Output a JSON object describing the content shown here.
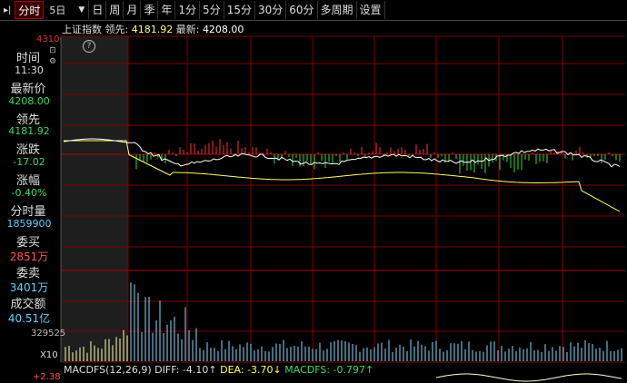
{
  "toolbar": {
    "pin": "▸|",
    "items": [
      "分时",
      "5日",
      "日",
      "周",
      "月",
      "季",
      "年",
      "1分",
      "5分",
      "15分",
      "30分",
      "60分",
      "多周期",
      "设置"
    ]
  },
  "info": {
    "index_name": "上证指数",
    "lead_label": "领先:",
    "lead_value": "4181.92",
    "latest_label": "最新:",
    "latest_value": "4208.00"
  },
  "price_scale_top": "4310",
  "volume_scale": "329525",
  "volume_multiplier": "X10",
  "macd_scale_bottom": "+2.38",
  "sidebar": {
    "time_label": "时间",
    "time_value": "11:30",
    "latest_label": "最新价",
    "latest_value": "4208.00",
    "lead_label": "领先",
    "lead_value": "4181.92",
    "change_label": "涨跌",
    "change_value": "-17.02",
    "pct_label": "涨幅",
    "pct_value": "-0.40%",
    "vol_label": "分时量",
    "vol_value": "1859900",
    "bid_label": "委买",
    "bid_value": "2851万",
    "ask_label": "委卖",
    "ask_value": "3401万",
    "amount_label": "成交额",
    "amount_value": "40.51亿"
  },
  "macd": {
    "title": "MACDFS(12,26,9)",
    "diff_label": "DIFF:",
    "diff_value": "-4.10↑",
    "dea_label": "DEA:",
    "dea_value": "-3.70↓",
    "macdfs_label": "MACDFS:",
    "macdfs_value": "-0.797↑"
  },
  "colors": {
    "grid": "#7a0000",
    "price_line": "#ffffff",
    "avg_line": "#ffff66",
    "up_bar": "#ff3030",
    "down_bar": "#33dd33",
    "vol_bar": "#88ddff"
  }
}
